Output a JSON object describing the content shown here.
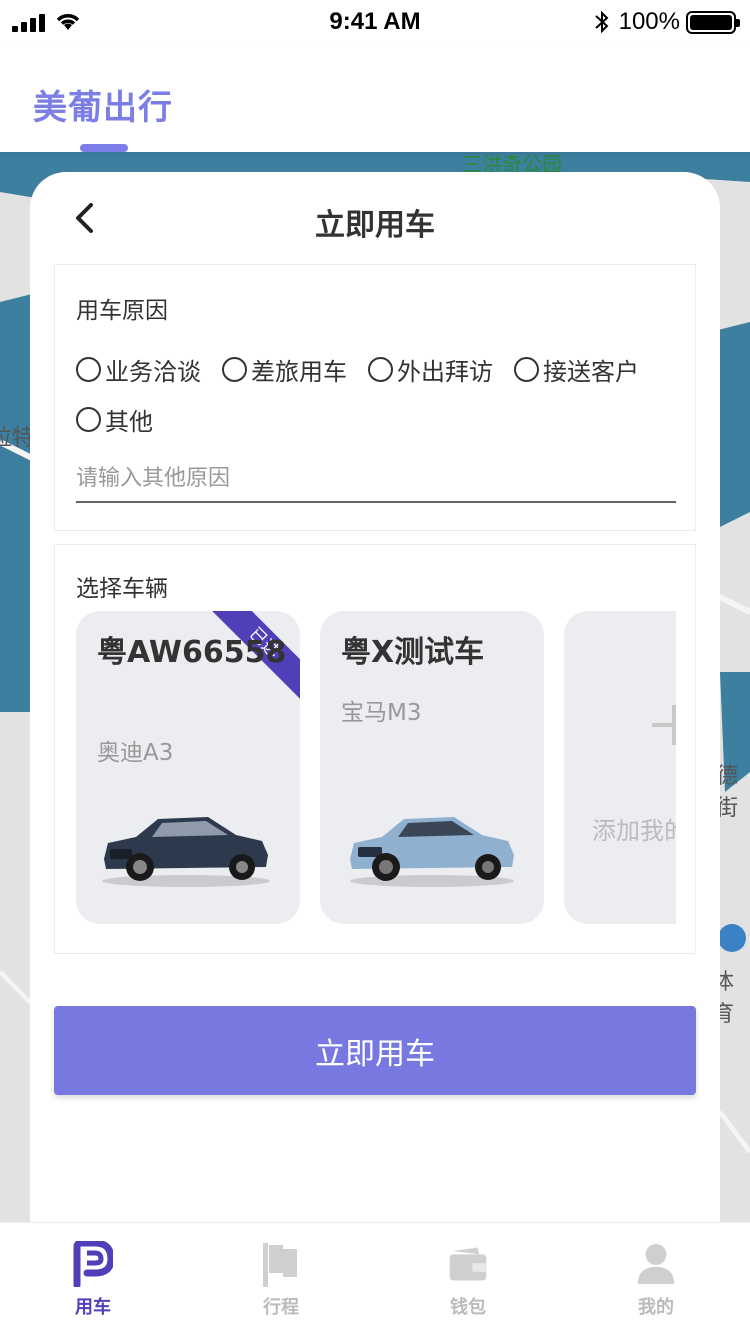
{
  "status_bar": {
    "time": "9:41 AM",
    "battery": "100%"
  },
  "header": {
    "brand": "美葡出行"
  },
  "map": {
    "labels": [
      "三洪奇公园",
      "拉特",
      "德街",
      "体育"
    ]
  },
  "sheet": {
    "title": "立即用车",
    "reason": {
      "label": "用车原因",
      "options": [
        "业务洽谈",
        "差旅用车",
        "外出拜访",
        "接送客户",
        "其他"
      ],
      "other_placeholder": "请输入其他原因"
    },
    "vehicle": {
      "label": "选择车辆",
      "cars": [
        {
          "plate": "粤AW66558",
          "model": "奥迪A3",
          "selected": true,
          "badge": "已选"
        },
        {
          "plate": "粤X测试车",
          "model": "宝马M3",
          "selected": false
        }
      ],
      "add_label": "添加我的车"
    },
    "submit": "立即用车"
  },
  "tabs": [
    {
      "label": "用车",
      "icon": "p-logo-icon",
      "active": true
    },
    {
      "label": "行程",
      "icon": "flag-icon",
      "active": false
    },
    {
      "label": "钱包",
      "icon": "wallet-icon",
      "active": false
    },
    {
      "label": "我的",
      "icon": "user-icon",
      "active": false
    }
  ],
  "colors": {
    "accent": "#7779e1",
    "active_tab": "#4f3fb8",
    "brand": "#7a7ee6"
  }
}
